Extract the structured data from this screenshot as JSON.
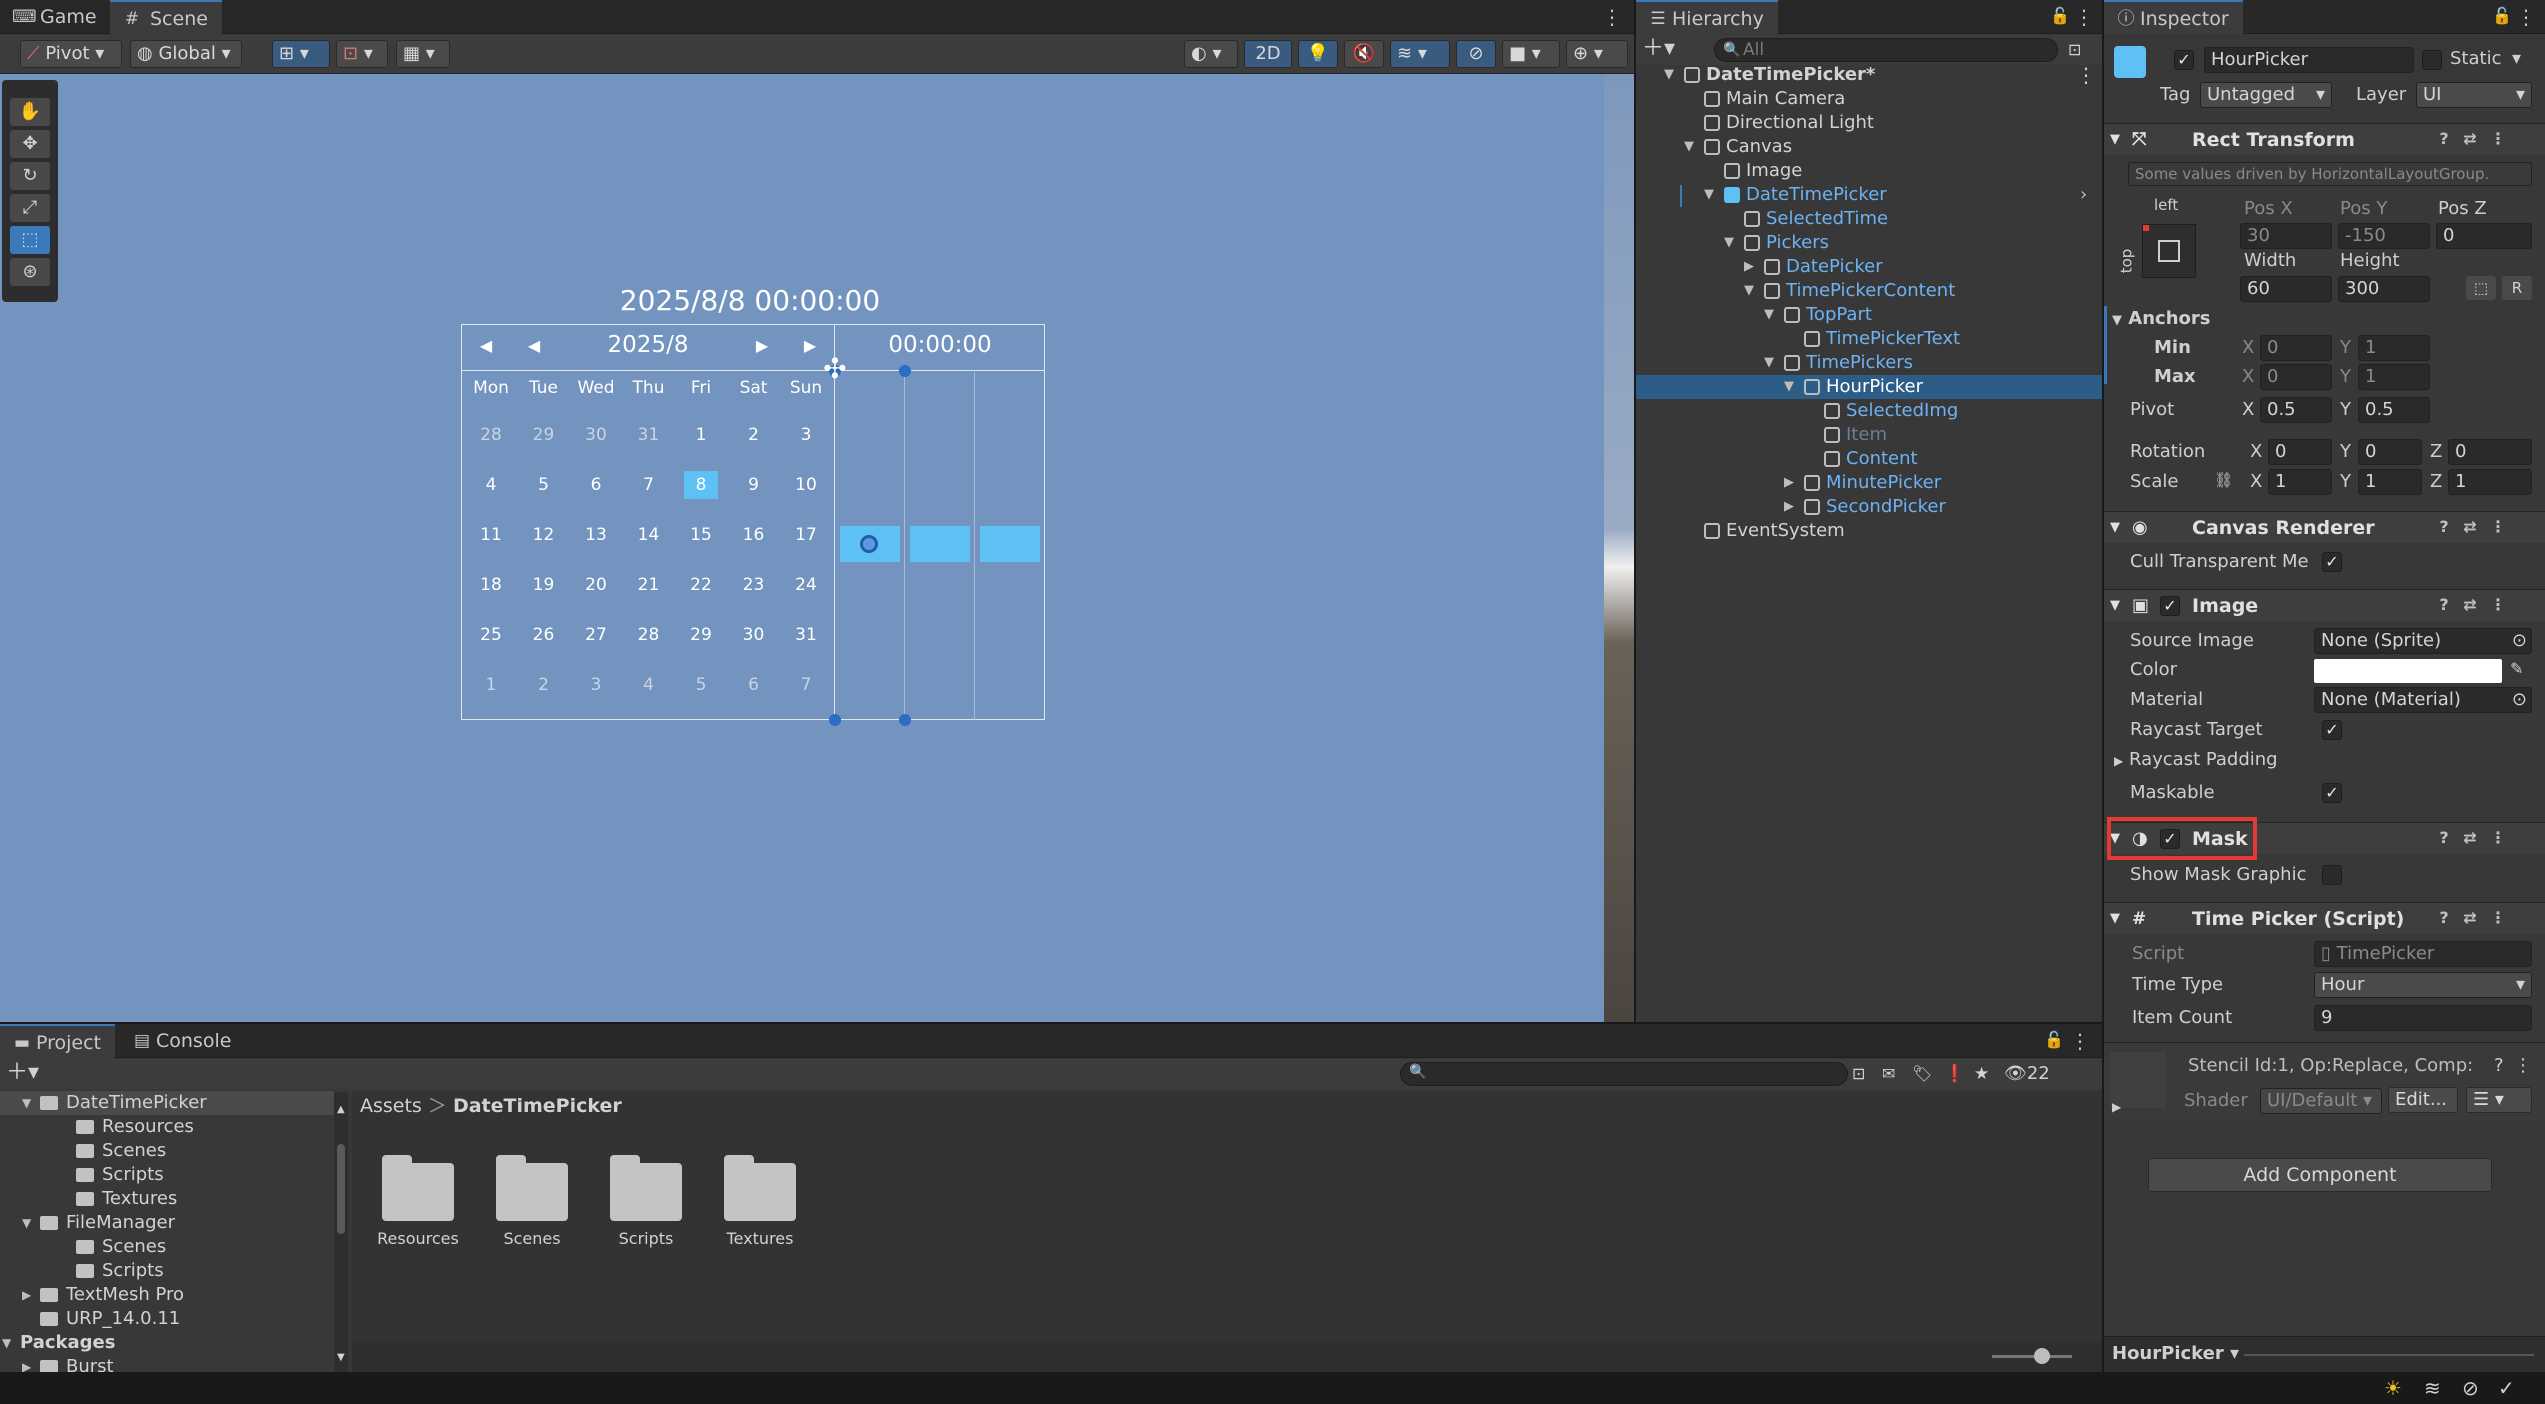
{
  "scene_panel": {
    "tabs": [
      {
        "label": "Game",
        "icon": "gamepad-icon"
      },
      {
        "label": "Scene",
        "icon": "grid-icon"
      }
    ],
    "toolbar": {
      "pivot": "Pivot",
      "global": "Global",
      "mode_2d": "2D"
    },
    "calendar": {
      "selected_datetime": "2025/8/8 00:00:00",
      "month_label": "2025/8",
      "prev_year": "◀",
      "prev_month": "◀",
      "next_month": "▶",
      "next_year": "▶",
      "time_label": "00:00:00",
      "weekdays": [
        "Mon",
        "Tue",
        "Wed",
        "Thu",
        "Fri",
        "Sat",
        "Sun"
      ],
      "weeks": [
        [
          "28",
          "29",
          "30",
          "31",
          "1",
          "2",
          "3"
        ],
        [
          "4",
          "5",
          "6",
          "7",
          "8",
          "9",
          "10"
        ],
        [
          "11",
          "12",
          "13",
          "14",
          "15",
          "16",
          "17"
        ],
        [
          "18",
          "19",
          "20",
          "21",
          "22",
          "23",
          "24"
        ],
        [
          "25",
          "26",
          "27",
          "28",
          "29",
          "30",
          "31"
        ],
        [
          "1",
          "2",
          "3",
          "4",
          "5",
          "6",
          "7"
        ]
      ],
      "selected_day": "8"
    }
  },
  "hierarchy": {
    "tab": "Hierarchy",
    "search_placeholder": "All",
    "items": [
      {
        "label": "DateTimePicker*",
        "depth": 0,
        "type": "scene"
      },
      {
        "label": "Main Camera",
        "depth": 1
      },
      {
        "label": "Directional Light",
        "depth": 1
      },
      {
        "label": "Canvas",
        "depth": 1
      },
      {
        "label": "Image",
        "depth": 2
      },
      {
        "label": "DateTimePicker",
        "depth": 2,
        "blue": true
      },
      {
        "label": "SelectedTime",
        "depth": 3,
        "blue": true
      },
      {
        "label": "Pickers",
        "depth": 3,
        "blue": true
      },
      {
        "label": "DatePicker",
        "depth": 4,
        "blue": true
      },
      {
        "label": "TimePickerContent",
        "depth": 4,
        "blue": true
      },
      {
        "label": "TopPart",
        "depth": 5,
        "blue": true
      },
      {
        "label": "TimePickerText",
        "depth": 6,
        "blue": true
      },
      {
        "label": "TimePickers",
        "depth": 5,
        "blue": true
      },
      {
        "label": "HourPicker",
        "depth": 6,
        "selected": true
      },
      {
        "label": "SelectedImg",
        "depth": 7,
        "blue": true
      },
      {
        "label": "Item",
        "depth": 7,
        "dim": true
      },
      {
        "label": "Content",
        "depth": 7,
        "blue": true
      },
      {
        "label": "MinutePicker",
        "depth": 6,
        "blue": true
      },
      {
        "label": "SecondPicker",
        "depth": 6,
        "blue": true
      },
      {
        "label": "EventSystem",
        "depth": 1
      }
    ]
  },
  "inspector": {
    "tab": "Inspector",
    "object_name": "HourPicker",
    "static_label": "Static",
    "tag_label": "Tag",
    "tag_value": "Untagged",
    "layer_label": "Layer",
    "layer_value": "UI",
    "rect_transform": {
      "title": "Rect Transform",
      "note": "Some values driven by HorizontalLayoutGroup.",
      "anchor_h": "left",
      "anchor_v": "top",
      "pos_x_label": "Pos X",
      "pos_y_label": "Pos Y",
      "pos_z_label": "Pos Z",
      "pos_x": "30",
      "pos_y": "-150",
      "pos_z": "0",
      "width_label": "Width",
      "height_label": "Height",
      "width": "60",
      "height": "300",
      "anchors_label": "Anchors",
      "min_label": "Min",
      "max_label": "Max",
      "min_x": "0",
      "min_y": "1",
      "max_x": "0",
      "max_y": "1",
      "pivot_label": "Pivot",
      "pivot_x": "0.5",
      "pivot_y": "0.5",
      "rotation_label": "Rotation",
      "rot_x": "0",
      "rot_y": "0",
      "rot_z": "0",
      "scale_label": "Scale",
      "scale_x": "1",
      "scale_y": "1",
      "scale_z": "1",
      "x": "X",
      "y": "Y",
      "z": "Z",
      "r": "R"
    },
    "canvas_renderer": {
      "title": "Canvas Renderer",
      "cull_label": "Cull Transparent Me"
    },
    "image": {
      "title": "Image",
      "source_label": "Source Image",
      "source_value": "None (Sprite)",
      "color_label": "Color",
      "material_label": "Material",
      "material_value": "None (Material)",
      "raycast_label": "Raycast Target",
      "padding_label": "Raycast Padding",
      "maskable_label": "Maskable"
    },
    "mask": {
      "title": "Mask",
      "show_graphic_label": "Show Mask Graphic",
      "highlight_color": "#e53935"
    },
    "time_picker": {
      "title": "Time Picker (Script)",
      "script_label": "Script",
      "script_value": "TimePicker",
      "time_type_label": "Time Type",
      "time_type_value": "Hour",
      "item_count_label": "Item Count",
      "item_count_value": "9"
    },
    "material_info": {
      "stencil": "Stencil Id:1, Op:Replace, Comp:",
      "shader_label": "Shader",
      "shader_value": "UI/Default",
      "edit_label": "Edit..."
    },
    "add_component": "Add Component",
    "footer_name": "HourPicker"
  },
  "project": {
    "tabs": [
      {
        "label": "Project"
      },
      {
        "label": "Console"
      }
    ],
    "count": "22",
    "breadcrumb": [
      "Assets",
      "DateTimePicker"
    ],
    "tree": [
      {
        "label": "DateTimePicker",
        "depth": 1,
        "selected": true
      },
      {
        "label": "Resources",
        "depth": 2
      },
      {
        "label": "Scenes",
        "depth": 2
      },
      {
        "label": "Scripts",
        "depth": 2
      },
      {
        "label": "Textures",
        "depth": 2
      },
      {
        "label": "FileManager",
        "depth": 1
      },
      {
        "label": "Scenes",
        "depth": 2
      },
      {
        "label": "Scripts",
        "depth": 2
      },
      {
        "label": "TextMesh Pro",
        "depth": 1
      },
      {
        "label": "URP_14.0.11",
        "depth": 1
      },
      {
        "label": "Packages",
        "depth": 0,
        "bold": true
      },
      {
        "label": "Burst",
        "depth": 1
      }
    ],
    "assets": [
      "Resources",
      "Scenes",
      "Scripts",
      "Textures"
    ]
  },
  "colors": {
    "accent": "#3a79bb",
    "selection": "#2c5d87",
    "scene_bg": "#7394bf",
    "highlight": "#5ec1f5"
  }
}
